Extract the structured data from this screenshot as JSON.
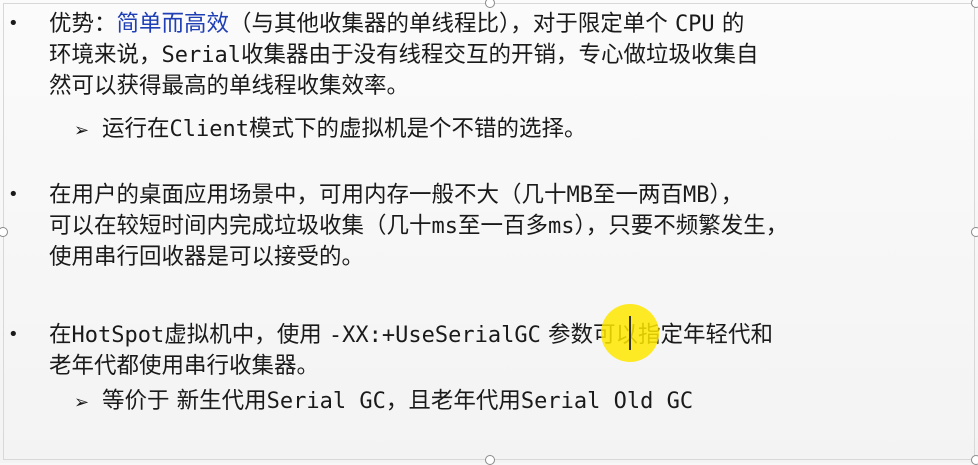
{
  "slide": {
    "bullet_symbol": "•",
    "sub_arrow_symbol": "➢",
    "bullets": [
      {
        "prefix": "优势：",
        "highlight": "简单而高效",
        "line1_rest_a": "（与其他收集器的单线程比），对于限定单个 ",
        "line1_cpu": "CPU",
        "line1_rest_b": " 的",
        "line2_a": "环境来说，",
        "line2_serial": "Serial",
        "line2_b": "收集器由于没有线程交互的开销，专心做垃圾收集自",
        "line3": "然可以获得最高的单线程收集效率。",
        "sub_a": "运行在",
        "sub_client": "Client",
        "sub_b": "模式下的虚拟机是个不错的选择。"
      },
      {
        "line1_a": "在用户的桌面应用场景中，可用内存一般不大（几十",
        "line1_mb1": "MB",
        "line1_b": "至一两百",
        "line1_mb2": "MB",
        "line1_c": "），",
        "line2_a": "可以在较短时间内完成垃圾收集（几十",
        "line2_ms1": "ms",
        "line2_b": "至一百多",
        "line2_ms2": "ms",
        "line2_c": "），只要不频繁发生，",
        "line3": "使用串行回收器是可以接受的。"
      },
      {
        "line1_a": "在",
        "line1_hotspot": "HotSpot",
        "line1_b": "虚拟机中，使用 ",
        "line1_flag": "-XX:+UseSerialGC",
        "line1_c": " 参数可以指定年轻代和",
        "line2": "老年代都使用串行收集器。",
        "sub_a": "等价于  新生代用",
        "sub_serial_gc": "Serial GC",
        "sub_b": "，且老年代用",
        "sub_serial_old": "Serial Old GC"
      }
    ]
  }
}
